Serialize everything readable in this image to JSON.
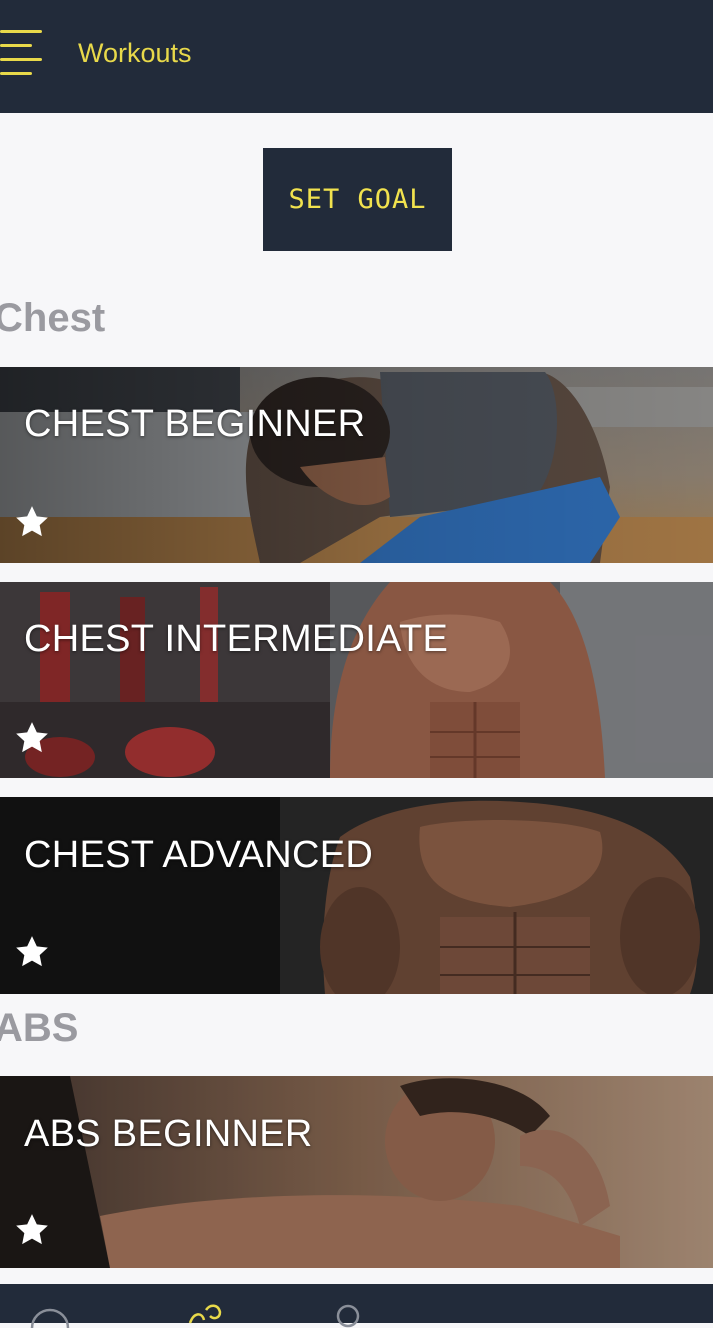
{
  "appbar": {
    "title": "Workouts",
    "menu_icon": "hamburger-menu-icon"
  },
  "goal_button": {
    "label": "SET GOAL"
  },
  "sections": [
    {
      "title": "Chest",
      "workouts": [
        {
          "label": "CHEST BEGINNER",
          "icon": "star-icon"
        },
        {
          "label": "CHEST INTERMEDIATE",
          "icon": "star-icon"
        },
        {
          "label": "CHEST ADVANCED",
          "icon": "star-icon"
        }
      ]
    },
    {
      "title": "ABS",
      "workouts": [
        {
          "label": "ABS BEGINNER",
          "icon": "star-icon"
        }
      ]
    }
  ],
  "bottom_nav": {
    "items": [
      "clock-icon",
      "workout-icon",
      "profile-icon"
    ]
  },
  "colors": {
    "bar": "#222b3a",
    "accent": "#e8d94a",
    "background": "#f7f7f9"
  }
}
